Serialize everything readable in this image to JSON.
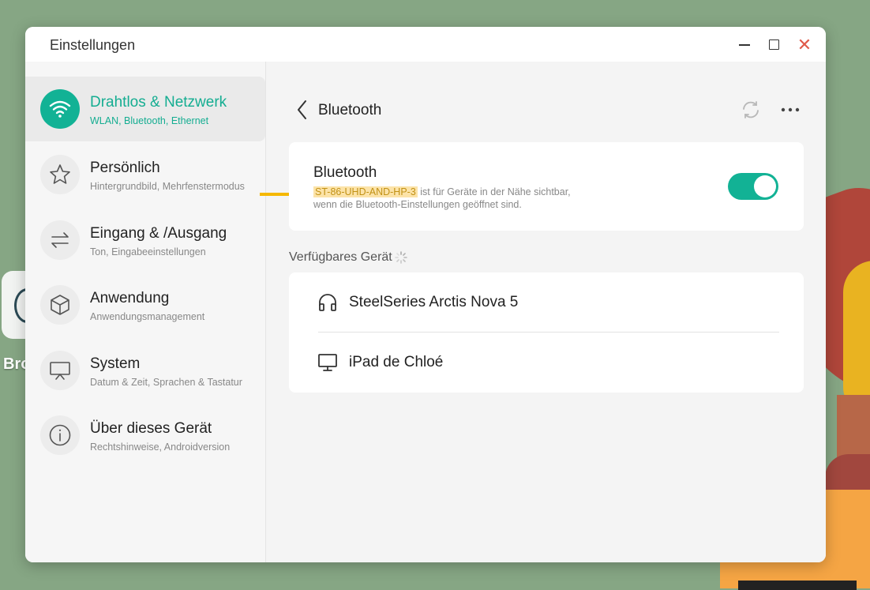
{
  "desktop": {
    "icon_label": "Bro"
  },
  "window": {
    "title": "Einstellungen",
    "close_glyph": "✕"
  },
  "sidebar": {
    "items": [
      {
        "title": "Drahtlos & Netzwerk",
        "subtitle": "WLAN, Bluetooth, Ethernet",
        "icon": "wifi-icon",
        "active": true
      },
      {
        "title": "Persönlich",
        "subtitle": "Hintergrundbild, Mehrfenstermodus",
        "icon": "star-icon"
      },
      {
        "title": "Eingang & /Ausgang",
        "subtitle": "Ton, Eingabeeinstellungen",
        "icon": "swap-arrows-icon"
      },
      {
        "title": "Anwendung",
        "subtitle": "Anwendungsmanagement",
        "icon": "cube-icon"
      },
      {
        "title": "System",
        "subtitle": "Datum & Zeit, Sprachen & Tastatur",
        "icon": "display-icon"
      },
      {
        "title": "Über dieses Gerät",
        "subtitle": "Rechtshinweise, Androidversion",
        "icon": "info-icon"
      }
    ]
  },
  "main": {
    "title": "Bluetooth",
    "bluetooth": {
      "label": "Bluetooth",
      "device_name": "ST-86-UHD-AND-HP-3",
      "desc_line1_rest": " ist für Geräte in der Nähe sichtbar,",
      "desc_line2": "wenn die Bluetooth-Einstellungen geöffnet sind.",
      "enabled": true
    },
    "available_label": "Verfügbares Gerät",
    "devices": [
      {
        "name": "SteelSeries Arctis Nova 5",
        "icon": "headphones-icon"
      },
      {
        "name": "iPad de Chloé",
        "icon": "monitor-icon"
      }
    ]
  },
  "colors": {
    "accent": "#12b295",
    "highlight": "#fce3a8",
    "arrow": "#f5b800",
    "close": "#e05a4a"
  }
}
